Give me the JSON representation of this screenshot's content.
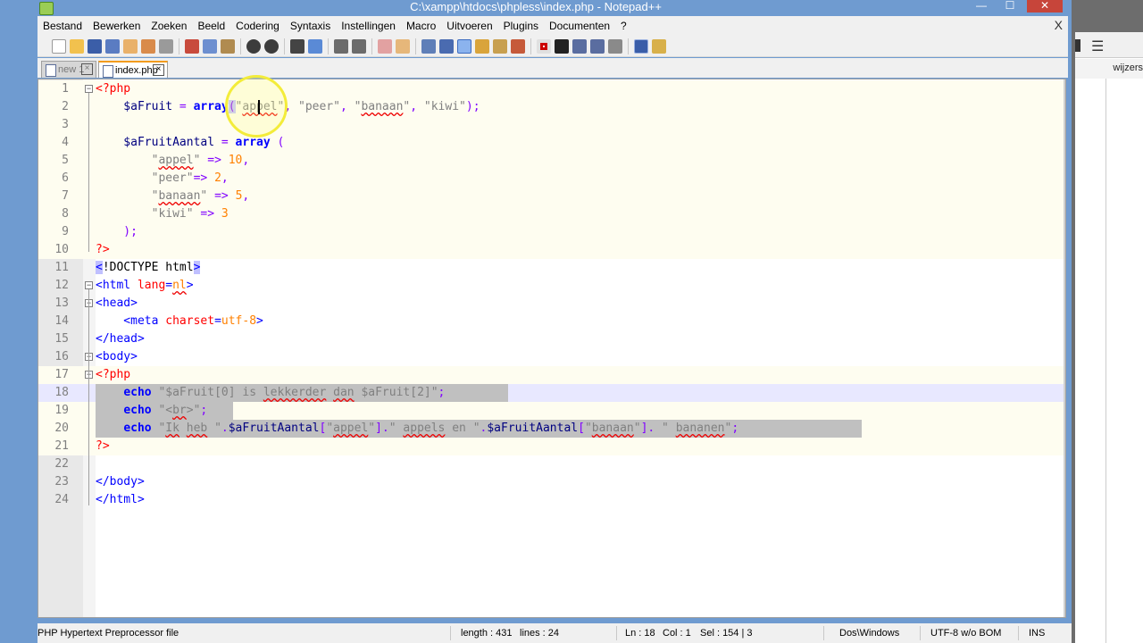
{
  "window": {
    "title": "C:\\xampp\\htdocs\\phpless\\index.php - Notepad++"
  },
  "menu": [
    "Bestand",
    "Bewerken",
    "Zoeken",
    "Beeld",
    "Codering",
    "Syntaxis",
    "Instellingen",
    "Macro",
    "Uitvoeren",
    "Plugins",
    "Documenten",
    "?"
  ],
  "menu_close": "X",
  "tabs": [
    {
      "label": "new  1"
    },
    {
      "label": "index.php"
    }
  ],
  "code_lines": [
    "<?php",
    "    $aFruit = array(\"appel\", \"peer\", \"banaan\", \"kiwi\");",
    "",
    "    $aFruitAantal = array (",
    "        \"appel\" => 10,",
    "        \"peer\"=> 2,",
    "        \"banaan\" => 5,",
    "        \"kiwi\" => 3",
    "    );",
    "?>",
    "<!DOCTYPE html>",
    "<html lang=nl>",
    "<head>",
    "    <meta charset=utf-8>",
    "</head>",
    "<body>",
    "<?php",
    "    echo \"$aFruit[0] is lekkerder dan $aFruit[2]\";",
    "    echo \"<br>\";",
    "    echo \"Ik heb \".$aFruitAantal[\"appel\"].\" appels en \".$aFruitAantal[\"banaan\"]. \" bananen\";",
    "?>",
    "",
    "</body>",
    "</html>"
  ],
  "line_numbers": [
    "1",
    "2",
    "3",
    "4",
    "5",
    "6",
    "7",
    "8",
    "9",
    "10",
    "11",
    "12",
    "13",
    "14",
    "15",
    "16",
    "17",
    "18",
    "19",
    "20",
    "21",
    "22",
    "23",
    "24"
  ],
  "status": {
    "filetype": "PHP Hypertext Preprocessor file",
    "length": "length : 431",
    "lines": "lines : 24",
    "ln": "Ln : 18",
    "col": "Col : 1",
    "sel": "Sel : 154 | 3",
    "eol": "Dos\\Windows",
    "encoding": "UTF-8 w/o BOM",
    "mode": "INS"
  },
  "right_app": {
    "label": "wijzers"
  },
  "colors": {
    "title_bar": "#6f9bd0",
    "keyword": "#0000ff",
    "variable": "#000080",
    "string": "#808080",
    "number": "#ff8000",
    "operator": "#8000ff",
    "php_tag": "#ff0000",
    "selection": "#c0c0c0"
  }
}
